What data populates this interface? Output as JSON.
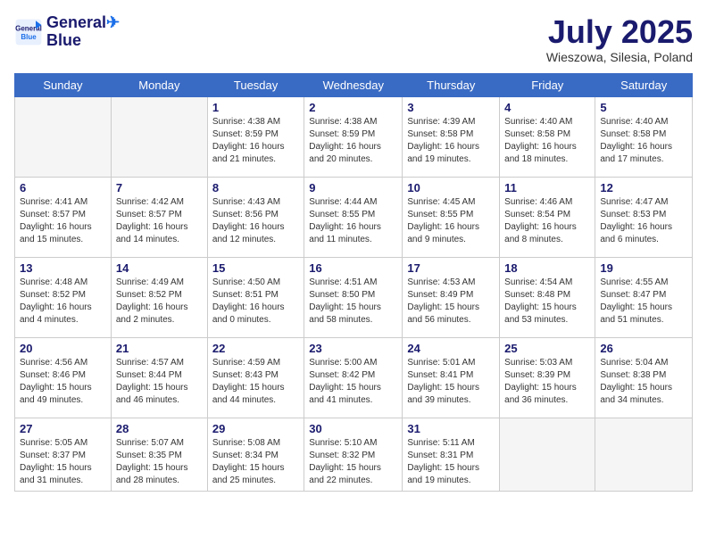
{
  "header": {
    "logo_line1": "General",
    "logo_line2": "Blue",
    "month": "July 2025",
    "location": "Wieszowa, Silesia, Poland"
  },
  "days_of_week": [
    "Sunday",
    "Monday",
    "Tuesday",
    "Wednesday",
    "Thursday",
    "Friday",
    "Saturday"
  ],
  "weeks": [
    [
      {
        "day": "",
        "info": ""
      },
      {
        "day": "",
        "info": ""
      },
      {
        "day": "1",
        "info": "Sunrise: 4:38 AM\nSunset: 8:59 PM\nDaylight: 16 hours\nand 21 minutes."
      },
      {
        "day": "2",
        "info": "Sunrise: 4:38 AM\nSunset: 8:59 PM\nDaylight: 16 hours\nand 20 minutes."
      },
      {
        "day": "3",
        "info": "Sunrise: 4:39 AM\nSunset: 8:58 PM\nDaylight: 16 hours\nand 19 minutes."
      },
      {
        "day": "4",
        "info": "Sunrise: 4:40 AM\nSunset: 8:58 PM\nDaylight: 16 hours\nand 18 minutes."
      },
      {
        "day": "5",
        "info": "Sunrise: 4:40 AM\nSunset: 8:58 PM\nDaylight: 16 hours\nand 17 minutes."
      }
    ],
    [
      {
        "day": "6",
        "info": "Sunrise: 4:41 AM\nSunset: 8:57 PM\nDaylight: 16 hours\nand 15 minutes."
      },
      {
        "day": "7",
        "info": "Sunrise: 4:42 AM\nSunset: 8:57 PM\nDaylight: 16 hours\nand 14 minutes."
      },
      {
        "day": "8",
        "info": "Sunrise: 4:43 AM\nSunset: 8:56 PM\nDaylight: 16 hours\nand 12 minutes."
      },
      {
        "day": "9",
        "info": "Sunrise: 4:44 AM\nSunset: 8:55 PM\nDaylight: 16 hours\nand 11 minutes."
      },
      {
        "day": "10",
        "info": "Sunrise: 4:45 AM\nSunset: 8:55 PM\nDaylight: 16 hours\nand 9 minutes."
      },
      {
        "day": "11",
        "info": "Sunrise: 4:46 AM\nSunset: 8:54 PM\nDaylight: 16 hours\nand 8 minutes."
      },
      {
        "day": "12",
        "info": "Sunrise: 4:47 AM\nSunset: 8:53 PM\nDaylight: 16 hours\nand 6 minutes."
      }
    ],
    [
      {
        "day": "13",
        "info": "Sunrise: 4:48 AM\nSunset: 8:52 PM\nDaylight: 16 hours\nand 4 minutes."
      },
      {
        "day": "14",
        "info": "Sunrise: 4:49 AM\nSunset: 8:52 PM\nDaylight: 16 hours\nand 2 minutes."
      },
      {
        "day": "15",
        "info": "Sunrise: 4:50 AM\nSunset: 8:51 PM\nDaylight: 16 hours\nand 0 minutes."
      },
      {
        "day": "16",
        "info": "Sunrise: 4:51 AM\nSunset: 8:50 PM\nDaylight: 15 hours\nand 58 minutes."
      },
      {
        "day": "17",
        "info": "Sunrise: 4:53 AM\nSunset: 8:49 PM\nDaylight: 15 hours\nand 56 minutes."
      },
      {
        "day": "18",
        "info": "Sunrise: 4:54 AM\nSunset: 8:48 PM\nDaylight: 15 hours\nand 53 minutes."
      },
      {
        "day": "19",
        "info": "Sunrise: 4:55 AM\nSunset: 8:47 PM\nDaylight: 15 hours\nand 51 minutes."
      }
    ],
    [
      {
        "day": "20",
        "info": "Sunrise: 4:56 AM\nSunset: 8:46 PM\nDaylight: 15 hours\nand 49 minutes."
      },
      {
        "day": "21",
        "info": "Sunrise: 4:57 AM\nSunset: 8:44 PM\nDaylight: 15 hours\nand 46 minutes."
      },
      {
        "day": "22",
        "info": "Sunrise: 4:59 AM\nSunset: 8:43 PM\nDaylight: 15 hours\nand 44 minutes."
      },
      {
        "day": "23",
        "info": "Sunrise: 5:00 AM\nSunset: 8:42 PM\nDaylight: 15 hours\nand 41 minutes."
      },
      {
        "day": "24",
        "info": "Sunrise: 5:01 AM\nSunset: 8:41 PM\nDaylight: 15 hours\nand 39 minutes."
      },
      {
        "day": "25",
        "info": "Sunrise: 5:03 AM\nSunset: 8:39 PM\nDaylight: 15 hours\nand 36 minutes."
      },
      {
        "day": "26",
        "info": "Sunrise: 5:04 AM\nSunset: 8:38 PM\nDaylight: 15 hours\nand 34 minutes."
      }
    ],
    [
      {
        "day": "27",
        "info": "Sunrise: 5:05 AM\nSunset: 8:37 PM\nDaylight: 15 hours\nand 31 minutes."
      },
      {
        "day": "28",
        "info": "Sunrise: 5:07 AM\nSunset: 8:35 PM\nDaylight: 15 hours\nand 28 minutes."
      },
      {
        "day": "29",
        "info": "Sunrise: 5:08 AM\nSunset: 8:34 PM\nDaylight: 15 hours\nand 25 minutes."
      },
      {
        "day": "30",
        "info": "Sunrise: 5:10 AM\nSunset: 8:32 PM\nDaylight: 15 hours\nand 22 minutes."
      },
      {
        "day": "31",
        "info": "Sunrise: 5:11 AM\nSunset: 8:31 PM\nDaylight: 15 hours\nand 19 minutes."
      },
      {
        "day": "",
        "info": ""
      },
      {
        "day": "",
        "info": ""
      }
    ]
  ]
}
